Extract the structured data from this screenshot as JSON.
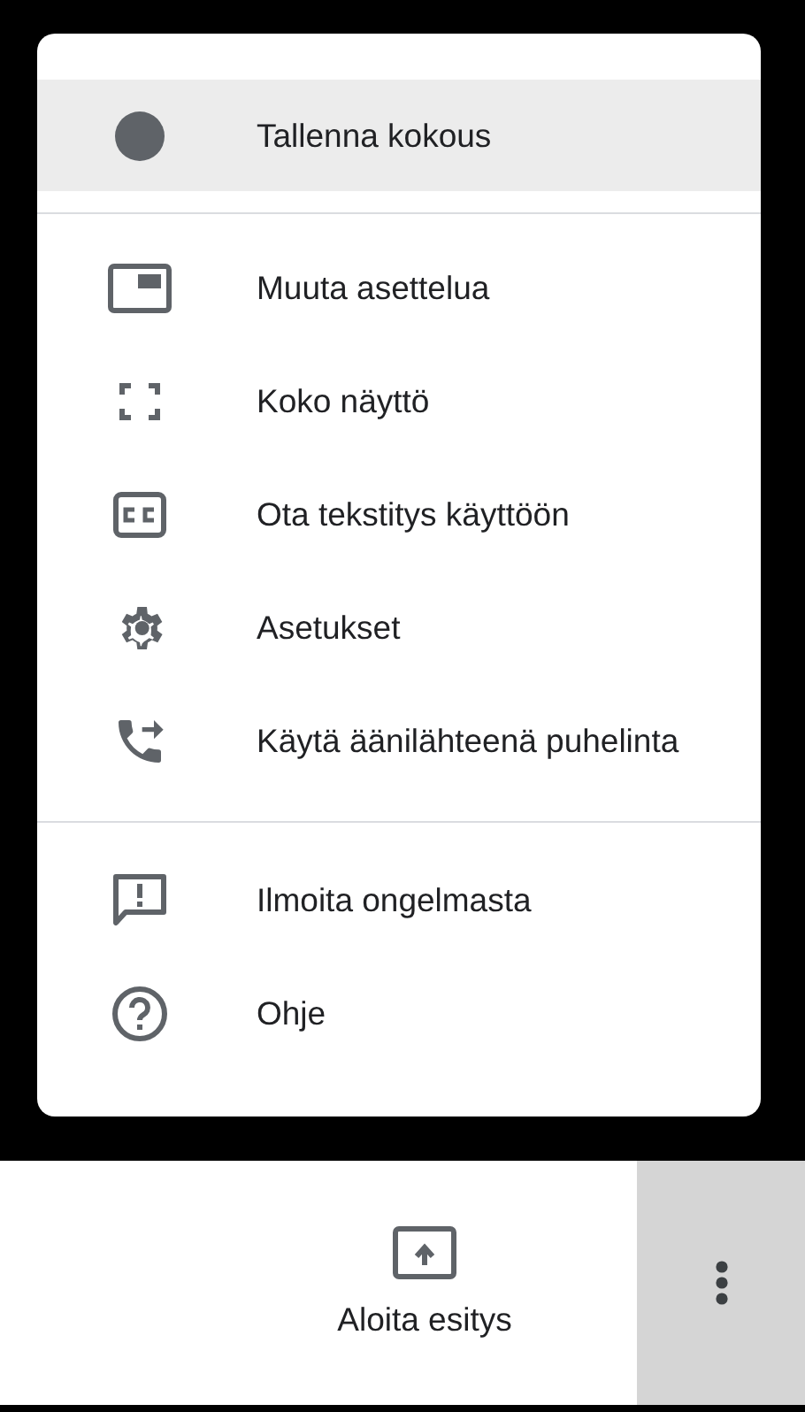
{
  "menu": {
    "sections": [
      [
        {
          "kind": "record",
          "label": "Tallenna kokous",
          "selected": true
        }
      ],
      [
        {
          "kind": "layout",
          "label": "Muuta asettelua",
          "selected": false
        },
        {
          "kind": "fullscreen",
          "label": "Koko näyttö",
          "selected": false
        },
        {
          "kind": "captions",
          "label": "Ota tekstitys käyttöön",
          "selected": false
        },
        {
          "kind": "settings",
          "label": "Asetukset",
          "selected": false
        },
        {
          "kind": "phone",
          "label": "Käytä äänilähteenä puhelinta",
          "selected": false
        }
      ],
      [
        {
          "kind": "feedback",
          "label": "Ilmoita ongelmasta",
          "selected": false
        },
        {
          "kind": "help",
          "label": "Ohje",
          "selected": false
        }
      ]
    ]
  },
  "bottom_bar": {
    "present_button": {
      "label": "Aloita esitys"
    },
    "more_button": {
      "selected": true
    }
  }
}
